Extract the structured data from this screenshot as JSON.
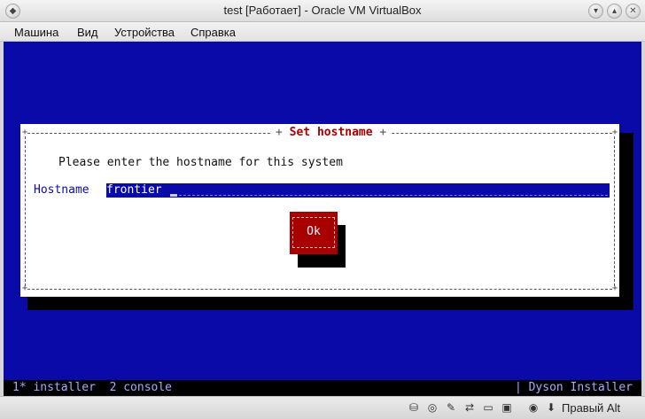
{
  "window": {
    "title": "test [Работает] - Oracle VM VirtualBox"
  },
  "menu": {
    "items": [
      "Машина",
      "Вид",
      "Устройства",
      "Справка"
    ]
  },
  "dialog": {
    "title": "Set hostname",
    "prompt": "Please enter the hostname for this system",
    "field_label": "Hostname",
    "field_value": "frontier",
    "ok_label": "Ok"
  },
  "statusline": {
    "left": "1* installer  2 console",
    "right": "| Dyson Installer"
  },
  "vbox_status": {
    "icons": [
      "hard-disk-icon",
      "optical-drive-icon",
      "usb-icon",
      "network-icon",
      "shared-folders-icon",
      "display-icon",
      "video-capture-icon",
      "mouse-integration-icon",
      "keyboard-capture-icon"
    ],
    "host_key": "Правый Alt"
  },
  "colors": {
    "vm_bg": "#0a0aa8",
    "dialog_title": "#a80000",
    "ok_button": "#a80000"
  }
}
